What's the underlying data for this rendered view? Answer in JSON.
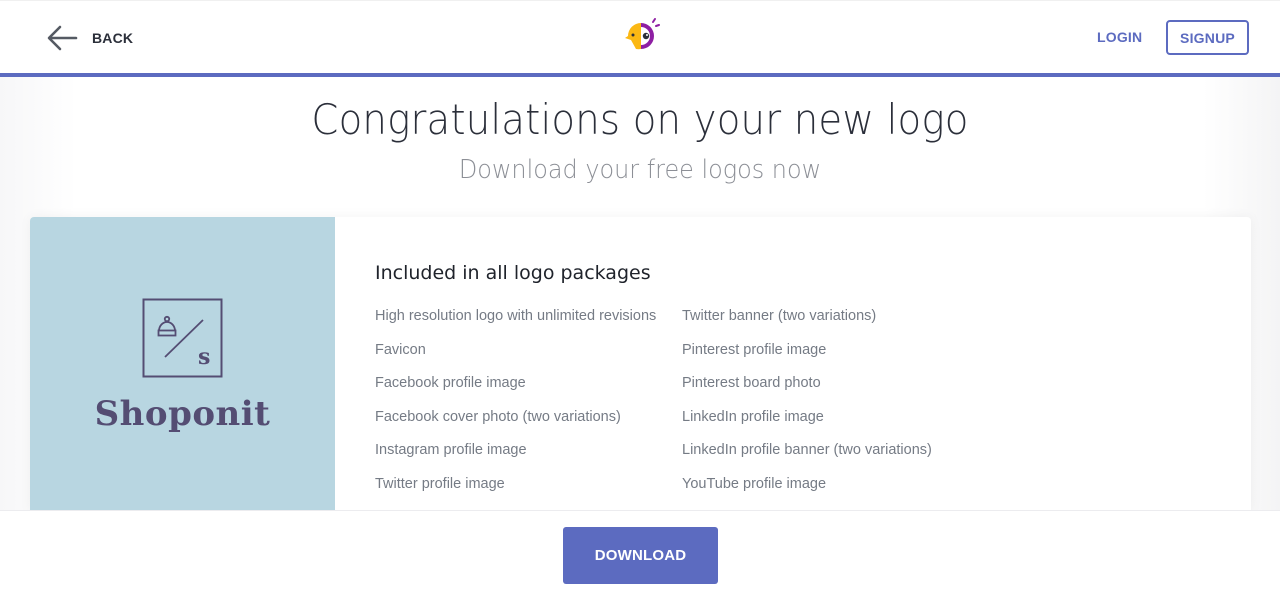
{
  "header": {
    "back_label": "BACK",
    "login_label": "LOGIN",
    "signup_label": "SIGNUP",
    "brand_icon": "parrot-logo-icon",
    "accent_color": "#5c6bc0"
  },
  "hero": {
    "title": "Congratulations on your new logo",
    "subtitle": "Download your free logos now"
  },
  "logo_preview": {
    "brand_name": "Shoponit",
    "monogram_letter": "s",
    "mark_icon": "beanie-hat-icon",
    "background_color": "#b8d6e1",
    "foreground_color": "#544d73"
  },
  "package": {
    "title": "Included in all logo packages",
    "column_1": [
      "High resolution logo with unlimited revisions",
      "Favicon",
      "Facebook profile image",
      "Facebook cover photo (two variations)",
      "Instagram profile image",
      "Twitter profile image"
    ],
    "column_2": [
      "Twitter banner (two variations)",
      "Pinterest profile image",
      "Pinterest board photo",
      "LinkedIn profile image",
      "LinkedIn profile banner (two variations)",
      "YouTube profile image"
    ]
  },
  "footer": {
    "download_label": "DOWNLOAD"
  }
}
